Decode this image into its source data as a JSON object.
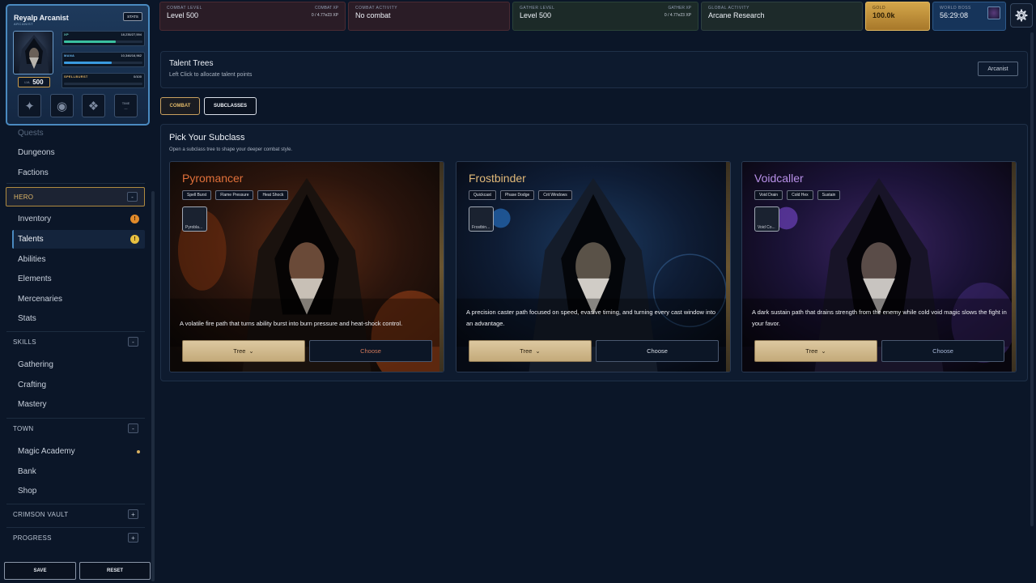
{
  "topbar": {
    "combat_level_label": "COMBAT LEVEL",
    "combat_level_value": "Level 500",
    "combat_xp_label": "COMBAT XP",
    "combat_xp_value": "0 / 4.77e23 XP",
    "combat_activity_label": "COMBAT ACTIVITY",
    "combat_activity_value": "No combat",
    "gather_level_label": "GATHER LEVEL",
    "gather_level_value": "Level 500",
    "gather_xp_label": "GATHER XP",
    "gather_xp_value": "0 / 4.77e23 XP",
    "global_activity_label": "GLOBAL ACTIVITY",
    "global_activity_value": "Arcane Research",
    "gold_label": "GOLD",
    "gold_value": "100.0k",
    "world_boss_label": "WORLD BOSS",
    "world_boss_value": "56:29:08",
    "settings_icon": "gear-icon"
  },
  "player": {
    "name": "Reyalp Arcanist",
    "class": "ARCANIST",
    "stats_button": "STATS",
    "level_label": "LVL",
    "level_value": "500",
    "xp_label": "XP",
    "xp_value": "18,235/27,594",
    "xp_fraction": 0.66,
    "mana_label": "MANA",
    "mana_value": "10,346/16,962",
    "mana_fraction": 0.61,
    "spellburst_label": "SPELLBURST",
    "spellburst_value": "0/100",
    "spellburst_fraction": 0,
    "slot_time_label": "TIME",
    "slot_time_value": "—"
  },
  "sidebar": {
    "items_top": [
      "Quests",
      "Dungeons",
      "Factions"
    ],
    "hero_label": "HERO",
    "hero_items": [
      "Inventory",
      "Talents",
      "Abilities",
      "Elements",
      "Mercenaries",
      "Stats"
    ],
    "inventory_badge": "!",
    "talents_badge": "!",
    "skills_label": "SKILLS",
    "skills_items": [
      "Gathering",
      "Crafting",
      "Mastery"
    ],
    "town_label": "TOWN",
    "town_items": [
      "Magic Academy",
      "Bank",
      "Shop"
    ],
    "crimson_vault_label": "CRIMSON VAULT",
    "progress_label": "PROGRESS",
    "collapse": "-",
    "expand": "+",
    "save_button": "SAVE",
    "reset_button": "RESET"
  },
  "header": {
    "title": "Talent Trees",
    "subtitle": "Left Click to allocate talent points",
    "class_button": "Arcanist"
  },
  "tabs": [
    "COMBAT",
    "SUBCLASSES"
  ],
  "subclass_panel": {
    "title": "Pick Your Subclass",
    "subtitle": "Open a subclass tree to shape your deeper combat style.",
    "tree_button": "Tree",
    "choose_button": "Choose",
    "cards": [
      {
        "name": "Pyromancer",
        "tags": [
          "Spell Burst",
          "Flame Pressure",
          "Heat Shock"
        ],
        "icon_label": "Pyrobla...",
        "description": "A volatile fire path that turns ability burst into burn pressure and heat-shock control.",
        "accent": "#e0703a"
      },
      {
        "name": "Frostbinder",
        "tags": [
          "Quickcast",
          "Phase Dodge",
          "Crit Windows"
        ],
        "icon_label": "Frostbin...",
        "description": "A precision caster path focused on speed, evasive timing, and turning every cast window into an advantage.",
        "accent": "#e0b878"
      },
      {
        "name": "Voidcaller",
        "tags": [
          "Void Drain",
          "Cold Hex",
          "Sustain"
        ],
        "icon_label": "Void Co...",
        "description": "A dark sustain path that drains strength from the enemy while cold void magic slows the fight in your favor.",
        "accent": "#b890e8"
      }
    ]
  }
}
